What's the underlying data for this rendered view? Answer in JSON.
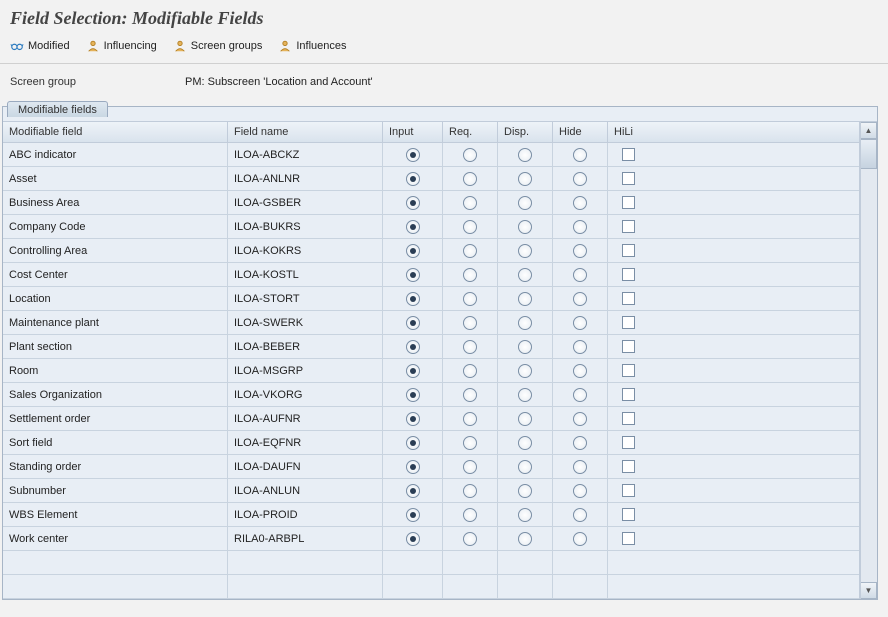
{
  "title": "Field Selection: Modifiable Fields",
  "toolbar": {
    "modified": "Modified",
    "influencing": "Influencing",
    "screen_groups": "Screen groups",
    "influences": "Influences"
  },
  "screen_group_label": "Screen group",
  "screen_group_value": "PM: Subscreen 'Location and Account'",
  "panel_title": "Modifiable fields",
  "columns": {
    "modifiable_field": "Modifiable field",
    "field_name": "Field name",
    "input": "Input",
    "req": "Req.",
    "disp": "Disp.",
    "hide": "Hide",
    "hili": "HiLi"
  },
  "rows": [
    {
      "label": "ABC indicator",
      "field": "ILOA-ABCKZ",
      "sel": "input"
    },
    {
      "label": "Asset",
      "field": "ILOA-ANLNR",
      "sel": "input"
    },
    {
      "label": "Business Area",
      "field": "ILOA-GSBER",
      "sel": "input"
    },
    {
      "label": "Company Code",
      "field": "ILOA-BUKRS",
      "sel": "input"
    },
    {
      "label": "Controlling Area",
      "field": "ILOA-KOKRS",
      "sel": "input"
    },
    {
      "label": "Cost Center",
      "field": "ILOA-KOSTL",
      "sel": "input"
    },
    {
      "label": "Location",
      "field": "ILOA-STORT",
      "sel": "input"
    },
    {
      "label": "Maintenance plant",
      "field": "ILOA-SWERK",
      "sel": "input"
    },
    {
      "label": "Plant section",
      "field": "ILOA-BEBER",
      "sel": "input"
    },
    {
      "label": "Room",
      "field": "ILOA-MSGRP",
      "sel": "input"
    },
    {
      "label": "Sales Organization",
      "field": "ILOA-VKORG",
      "sel": "input"
    },
    {
      "label": "Settlement order",
      "field": "ILOA-AUFNR",
      "sel": "input"
    },
    {
      "label": "Sort field",
      "field": "ILOA-EQFNR",
      "sel": "input"
    },
    {
      "label": "Standing order",
      "field": "ILOA-DAUFN",
      "sel": "input"
    },
    {
      "label": "Subnumber",
      "field": "ILOA-ANLUN",
      "sel": "input"
    },
    {
      "label": "WBS Element",
      "field": "ILOA-PROID",
      "sel": "input"
    },
    {
      "label": "Work center",
      "field": "RILA0-ARBPL",
      "sel": "input"
    },
    {
      "label": "",
      "field": "",
      "sel": ""
    },
    {
      "label": "",
      "field": "",
      "sel": ""
    }
  ]
}
